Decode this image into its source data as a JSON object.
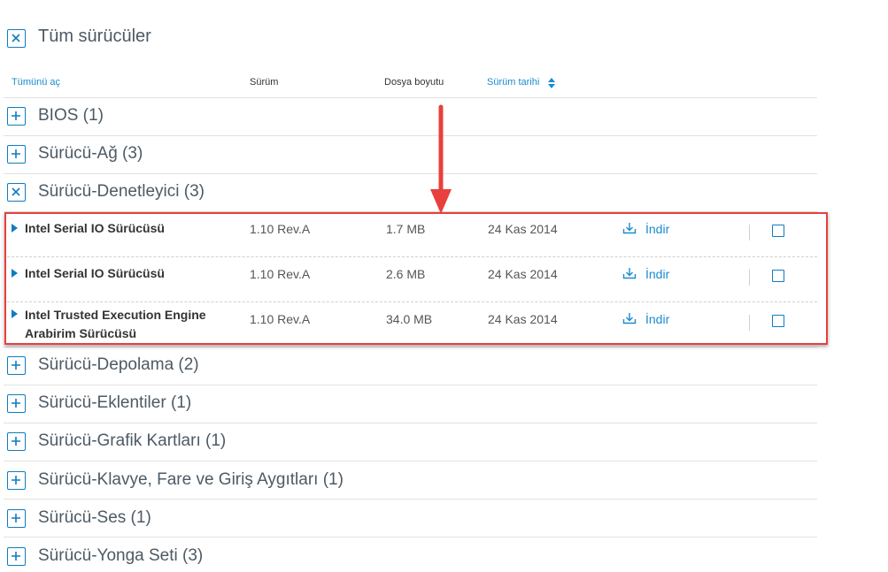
{
  "toggle_all": {
    "label": "Tüm sürücüler"
  },
  "columns": {
    "expand_all": "Tümünü aç",
    "version": "Sürüm",
    "file_size": "Dosya boyutu",
    "release_date": "Sürüm tarihi"
  },
  "categories": [
    {
      "label": "BIOS (1)",
      "expanded": false
    },
    {
      "label": "Sürücü-Ağ (3)",
      "expanded": false
    },
    {
      "label": "Sürücü-Denetleyici (3)",
      "expanded": true
    },
    {
      "label": "Sürücü-Depolama (2)",
      "expanded": false
    },
    {
      "label": "Sürücü-Eklentiler (1)",
      "expanded": false
    },
    {
      "label": "Sürücü-Grafik Kartları (1)",
      "expanded": false
    },
    {
      "label": "Sürücü-Klavye, Fare ve Giriş Aygıtları (1)",
      "expanded": false
    },
    {
      "label": "Sürücü-Ses (1)",
      "expanded": false
    },
    {
      "label": "Sürücü-Yonga Seti (3)",
      "expanded": false
    }
  ],
  "drivers": [
    {
      "name_line1": "Intel Serial IO Sürücüsü",
      "name_line2": "",
      "version": "1.10 Rev.A",
      "size": "1.7 MB",
      "date": "24 Kas 2014",
      "download": "İndir"
    },
    {
      "name_line1": "Intel Serial IO Sürücüsü",
      "name_line2": "",
      "version": "1.10 Rev.A",
      "size": "2.6 MB",
      "date": "24 Kas 2014",
      "download": "İndir"
    },
    {
      "name_line1": "Intel Trusted Execution Engine",
      "name_line2": "Arabirim Sürücüsü",
      "version": "1.10 Rev.A",
      "size": "34.0 MB",
      "date": "24 Kas 2014",
      "download": "İndir"
    }
  ],
  "colors": {
    "accent": "#0f7cc1",
    "link": "#1a8bd0",
    "highlight": "#e8403d"
  }
}
